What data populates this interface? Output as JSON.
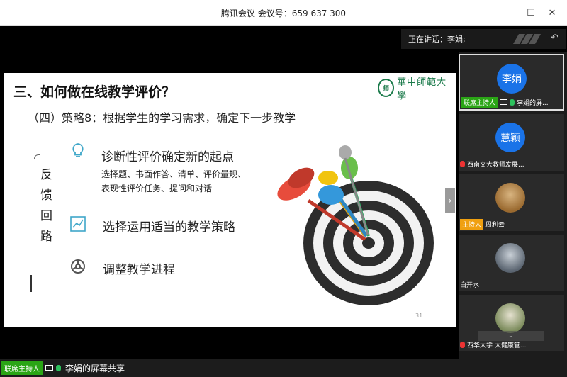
{
  "window": {
    "title": "腾讯会议 会议号：659 637 300"
  },
  "speaking": {
    "label": "正在讲话：李娟;"
  },
  "slide": {
    "title": "三、如何做在线教学评价？",
    "subtitle": "（四）策略8：根据学生的学习需求，确定下一步教学",
    "logo_text": "華中師範大學",
    "vertical_text": [
      "反",
      "馈",
      "回",
      "路"
    ],
    "items": [
      {
        "heading": "诊断性评价确定新的起点",
        "desc": [
          "选择题、书面作答、清单、评价量规、",
          "表现性评价任务、提问和对话"
        ],
        "icon": "lightbulb-icon"
      },
      {
        "heading": "选择运用适当的教学策略",
        "icon": "chart-icon"
      },
      {
        "heading": "调整教学进程",
        "icon": "steering-wheel-icon"
      }
    ],
    "page_number": "31"
  },
  "participants": [
    {
      "avatar_text": "李娟",
      "badge": "联席主持人",
      "name": "李娟的屏...",
      "mic": "green",
      "sharing": true
    },
    {
      "avatar_text": "慧颖",
      "name": "西南交大教师发展...",
      "mic": "red"
    },
    {
      "badge": "主持人",
      "name": "周利云",
      "mic": "none"
    },
    {
      "name": "白开水",
      "mic": "none"
    },
    {
      "name": "西华大学 大健康管...",
      "mic": "red"
    }
  ],
  "bottom": {
    "badge": "联席主持人",
    "text": "李娟的屏幕共享"
  },
  "colors": {
    "accent": "#1a73e8",
    "cohost": "#2aa515",
    "host": "#f0a010"
  }
}
